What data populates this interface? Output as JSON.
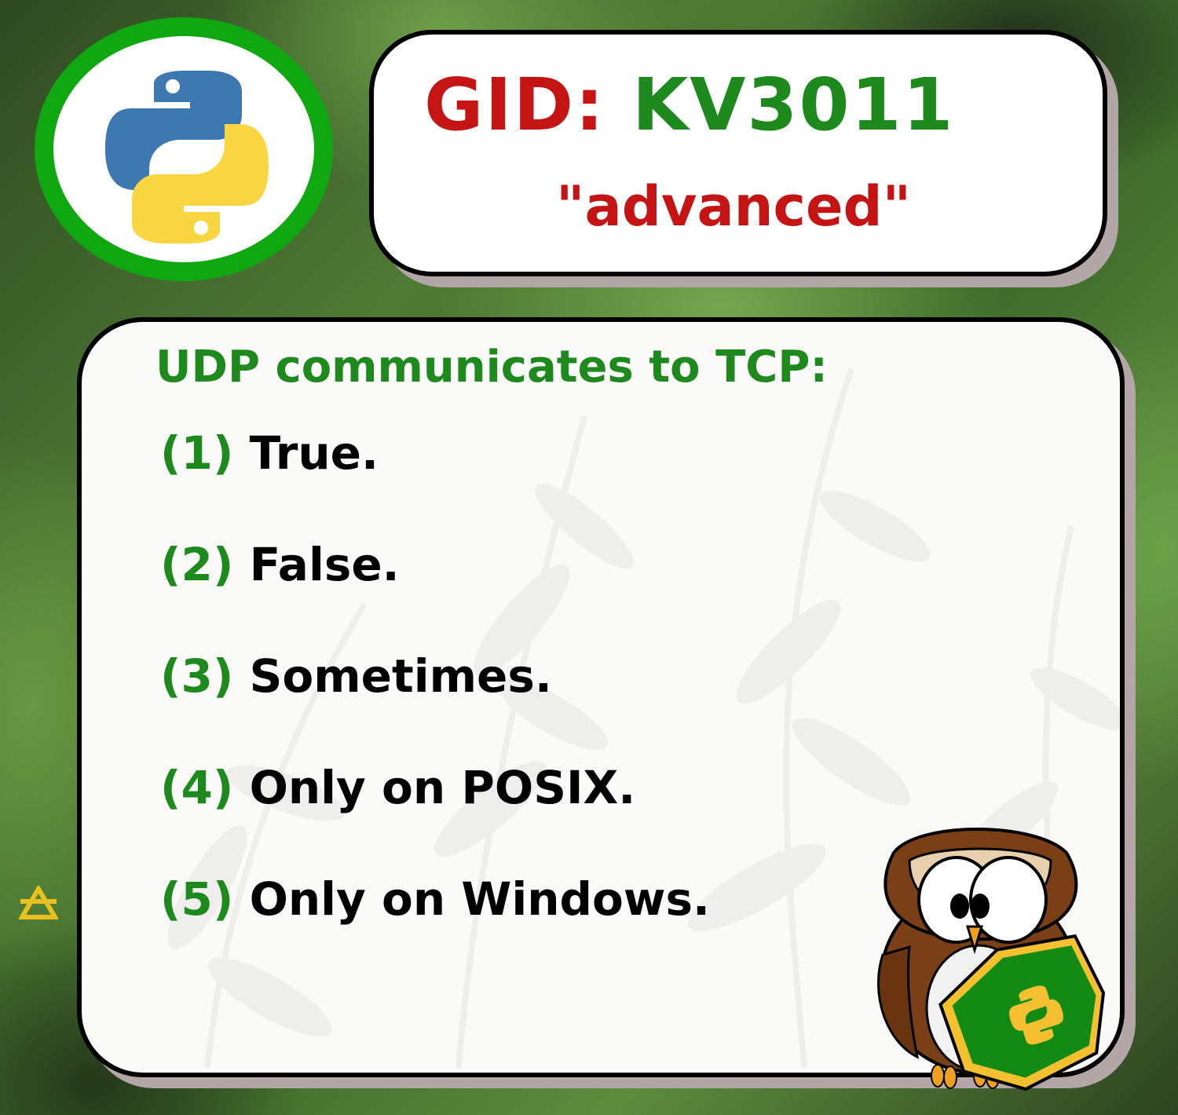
{
  "header": {
    "gid_label": "GID:",
    "gid_value": "KV3011",
    "level": "\"advanced\""
  },
  "question": {
    "text": "UDP communicates to TCP:"
  },
  "answers": [
    {
      "num": "(1)",
      "text": "True."
    },
    {
      "num": "(2)",
      "text": "False."
    },
    {
      "num": "(3)",
      "text": "Sometimes."
    },
    {
      "num": "(4)",
      "text": "Only on POSIX."
    },
    {
      "num": "(5)",
      "text": "Only on Windows."
    }
  ],
  "colors": {
    "title_red": "#c41414",
    "title_green": "#1e8a1e",
    "logo_ring": "#10a810"
  },
  "icons": [
    "python-logo-icon",
    "side-mark-icon",
    "owl-mascot-icon",
    "python-badge-icon"
  ]
}
